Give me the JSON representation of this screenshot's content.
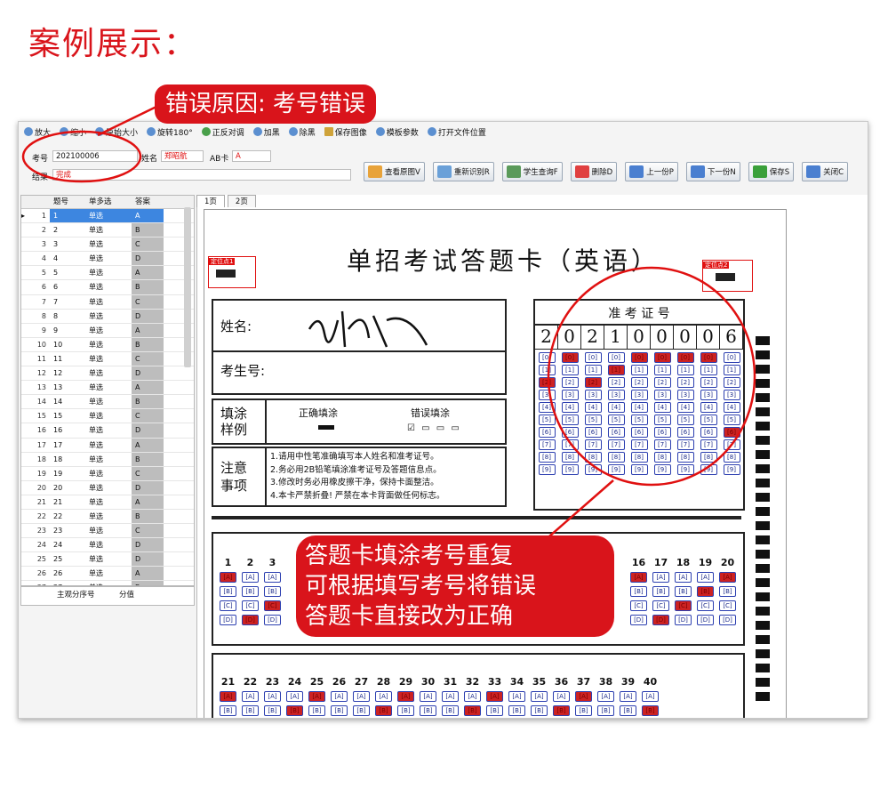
{
  "heading": "案例展示：",
  "callouts": {
    "top": "错误原因: 考号错误",
    "bottom": [
      "答题卡填涂考号重复",
      "可根据填写考号将错误",
      "答题卡直接改为正确"
    ]
  },
  "toolbar": [
    {
      "label": "放大",
      "icon": "zoom-in-icon"
    },
    {
      "label": "缩小",
      "icon": "zoom-out-icon"
    },
    {
      "label": "原始大小",
      "icon": "original-size-icon"
    },
    {
      "label": "旋转180°",
      "icon": "rotate-icon"
    },
    {
      "label": "正反对调",
      "icon": "swap-icon"
    },
    {
      "label": "加黑",
      "icon": "darken-icon"
    },
    {
      "label": "除黑",
      "icon": "remove-black-icon"
    },
    {
      "label": "保存图像",
      "icon": "save-image-icon"
    },
    {
      "label": "模板参数",
      "icon": "template-params-icon"
    },
    {
      "label": "打开文件位置",
      "icon": "open-folder-icon"
    }
  ],
  "fields": {
    "kaohao_label": "考号",
    "kaohao_value": "202100006",
    "name_label": "姓名",
    "name_value": "郑昭航",
    "ab_label": "AB卡",
    "ab_value": "A",
    "result_label": "结果",
    "result_value": "完成"
  },
  "actions": [
    {
      "label": "查看原图V",
      "icon": "view-original-icon",
      "color": "#e8a33a"
    },
    {
      "label": "重新识别R",
      "icon": "re-recognize-icon",
      "color": "#6aa0d8"
    },
    {
      "label": "学生查询F",
      "icon": "student-search-icon",
      "color": "#5a9a5a"
    },
    {
      "label": "删除D",
      "icon": "delete-icon",
      "color": "#e04040"
    },
    {
      "label": "上一份P",
      "icon": "previous-icon",
      "color": "#4a7fd0"
    },
    {
      "label": "下一份N",
      "icon": "next-icon",
      "color": "#4a7fd0"
    },
    {
      "label": "保存S",
      "icon": "save-icon",
      "color": "#3aa03a"
    },
    {
      "label": "关闭C",
      "icon": "close-icon",
      "color": "#4a7fd0"
    }
  ],
  "grid": {
    "headers": [
      "题号",
      "单多选",
      "答案"
    ],
    "rows": [
      {
        "n": "1",
        "q": "1",
        "t": "单选",
        "a": "A"
      },
      {
        "n": "2",
        "q": "2",
        "t": "单选",
        "a": "B"
      },
      {
        "n": "3",
        "q": "3",
        "t": "单选",
        "a": "C"
      },
      {
        "n": "4",
        "q": "4",
        "t": "单选",
        "a": "D"
      },
      {
        "n": "5",
        "q": "5",
        "t": "单选",
        "a": "A"
      },
      {
        "n": "6",
        "q": "6",
        "t": "单选",
        "a": "B"
      },
      {
        "n": "7",
        "q": "7",
        "t": "单选",
        "a": "C"
      },
      {
        "n": "8",
        "q": "8",
        "t": "单选",
        "a": "D"
      },
      {
        "n": "9",
        "q": "9",
        "t": "单选",
        "a": "A"
      },
      {
        "n": "10",
        "q": "10",
        "t": "单选",
        "a": "B"
      },
      {
        "n": "11",
        "q": "11",
        "t": "单选",
        "a": "C"
      },
      {
        "n": "12",
        "q": "12",
        "t": "单选",
        "a": "D"
      },
      {
        "n": "13",
        "q": "13",
        "t": "单选",
        "a": "A"
      },
      {
        "n": "14",
        "q": "14",
        "t": "单选",
        "a": "B"
      },
      {
        "n": "15",
        "q": "15",
        "t": "单选",
        "a": "C"
      },
      {
        "n": "16",
        "q": "16",
        "t": "单选",
        "a": "D"
      },
      {
        "n": "17",
        "q": "17",
        "t": "单选",
        "a": "A"
      },
      {
        "n": "18",
        "q": "18",
        "t": "单选",
        "a": "B"
      },
      {
        "n": "19",
        "q": "19",
        "t": "单选",
        "a": "C"
      },
      {
        "n": "20",
        "q": "20",
        "t": "单选",
        "a": "D"
      },
      {
        "n": "21",
        "q": "21",
        "t": "单选",
        "a": "A"
      },
      {
        "n": "22",
        "q": "22",
        "t": "单选",
        "a": "B"
      },
      {
        "n": "23",
        "q": "23",
        "t": "单选",
        "a": "C"
      },
      {
        "n": "24",
        "q": "24",
        "t": "单选",
        "a": "D"
      },
      {
        "n": "25",
        "q": "25",
        "t": "单选",
        "a": "D"
      },
      {
        "n": "26",
        "q": "26",
        "t": "单选",
        "a": "A"
      },
      {
        "n": "27",
        "q": "27",
        "t": "单选",
        "a": "B"
      },
      {
        "n": "28",
        "q": "28",
        "t": "单选",
        "a": "C"
      }
    ],
    "footer": [
      "主观分序号",
      "分值"
    ]
  },
  "tabs": [
    "1页",
    "2页"
  ],
  "sheet": {
    "title": "单招考试答题卡（英语）",
    "pos1": "定位点1",
    "pos2": "定位点2",
    "name_label": "姓名:",
    "kaoshenghao_label": "考生号:",
    "zhunkao_title": "准 考 证 号",
    "zhunkao_digits": [
      "2",
      "0",
      "2",
      "1",
      "0",
      "0",
      "0",
      "0",
      "6"
    ],
    "tianlu_label": "填涂样例",
    "correct_label": "正确填涂",
    "wrong_label": "错误填涂",
    "notes_label": "注意事项",
    "notes": [
      "1.请用中性笔准确填写本人姓名和准考证号。",
      "2.务必用2B铅笔填涂准考证号及答题信息点。",
      "3.修改时务必用橡皮擦干净，保持卡面整洁。",
      "4.本卡严禁折叠! 严禁在本卡背面做任何标志。"
    ],
    "q_row1_left": [
      "1",
      "2",
      "3"
    ],
    "q_row1_right": [
      "16",
      "17",
      "18",
      "19",
      "20"
    ],
    "q_row2": [
      "21",
      "22",
      "23",
      "24",
      "25",
      "26",
      "27",
      "28",
      "29",
      "30",
      "31",
      "32",
      "33",
      "34",
      "35",
      "36",
      "37",
      "38",
      "39",
      "40"
    ],
    "options": [
      "A",
      "B",
      "C",
      "D"
    ]
  }
}
